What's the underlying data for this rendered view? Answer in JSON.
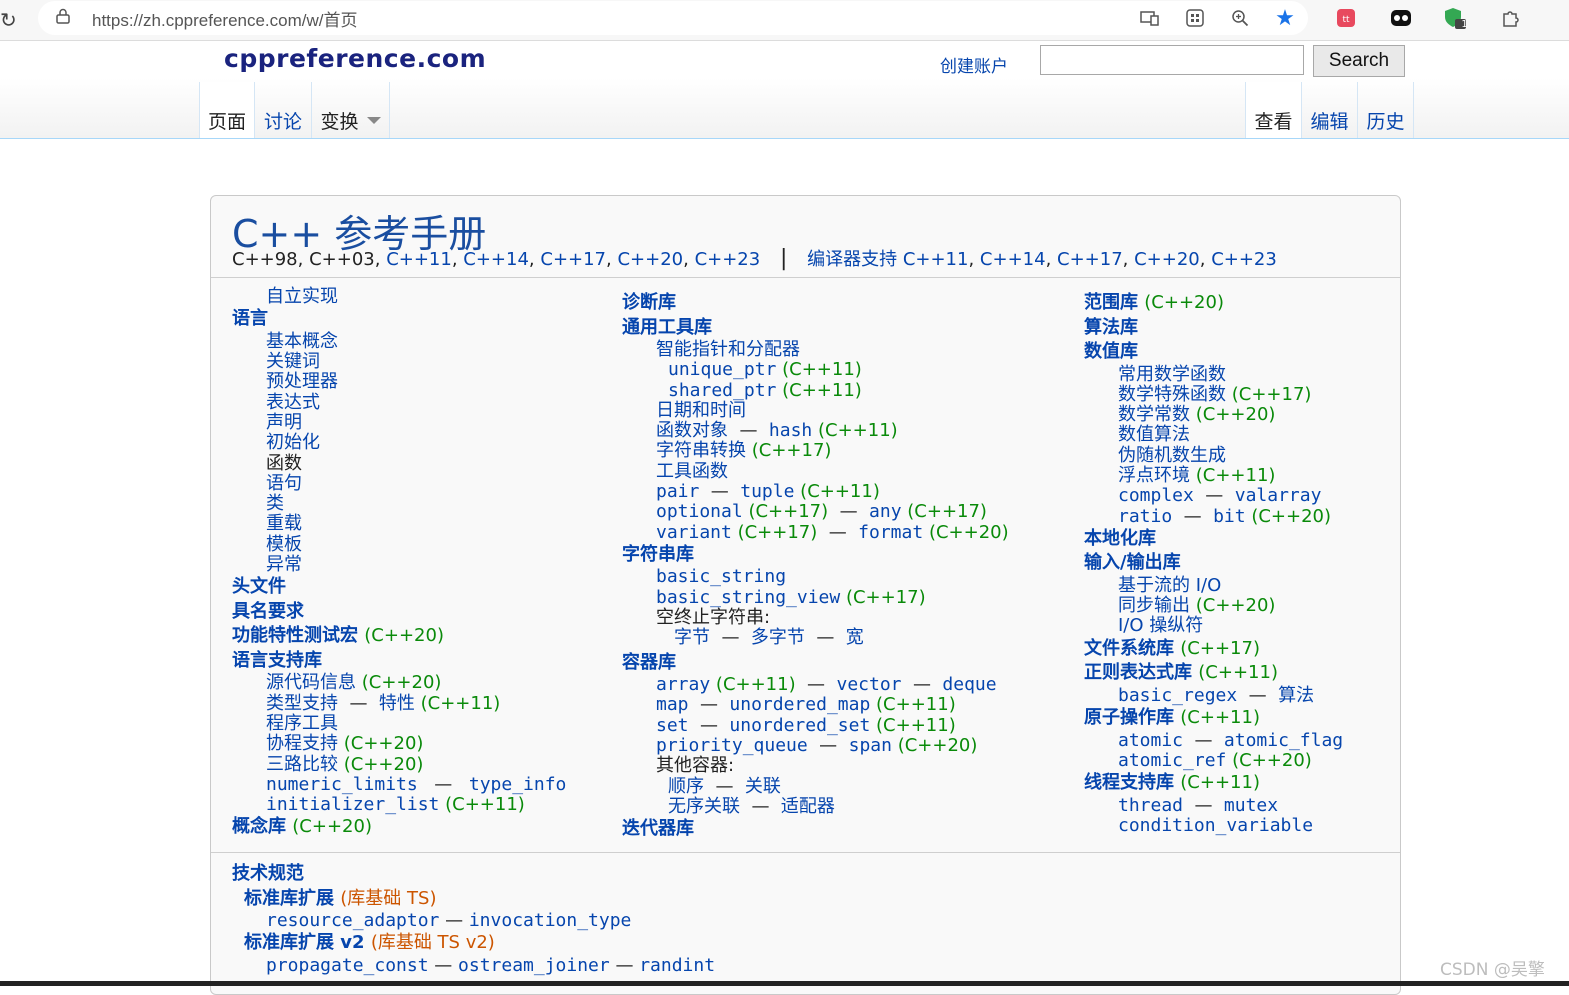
{
  "browser": {
    "url": "https://zh.cppreference.com/w/首页",
    "extension_badge": "1"
  },
  "site": {
    "logo": "cppreference.com",
    "create_account": "创建账户",
    "search_button": "Search",
    "search_placeholder": ""
  },
  "tabs_left": [
    "页面",
    "讨论",
    "变换"
  ],
  "tabs_right": [
    "查看",
    "编辑",
    "历史"
  ],
  "title": "C++ 参考手册",
  "std_versions_plain": "C++98, C++03,",
  "std_links": [
    "C++11",
    "C++14",
    "C++17",
    "C++20",
    "C++23"
  ],
  "compiler_support": "编译器支持",
  "compiler_links": [
    "C++11",
    "C++14",
    "C++17",
    "C++20",
    "C++23"
  ],
  "col1": {
    "freestanding": "自立实现",
    "language": "语言",
    "language_items": [
      "基本概念",
      "关键词",
      "预处理器",
      "表达式",
      "声明",
      "初始化",
      "函数",
      "语句",
      "类",
      "重载",
      "模板",
      "异常"
    ],
    "headers": "头文件",
    "named_req": "具名要求",
    "feature_test": "功能特性测试宏",
    "feature_test_ver": "(C++20)",
    "lang_support": "语言支持库",
    "source_location": "源代码信息",
    "source_location_ver": "(C++20)",
    "type_support": "类型支持",
    "traits": "特性",
    "traits_ver": "(C++11)",
    "program_utils": "程序工具",
    "coroutine": "协程支持",
    "coroutine_ver": "(C++20)",
    "three_way": "三路比较",
    "three_way_ver": "(C++20)",
    "numeric_limits": "numeric_limits",
    "type_info": "type_info",
    "initializer_list": "initializer_list",
    "initializer_list_ver": "(C++11)",
    "concepts": "概念库",
    "concepts_ver": "(C++20)"
  },
  "col2": {
    "diagnostics": "诊断库",
    "utilities": "通用工具库",
    "smart_ptr": "智能指针和分配器",
    "unique_ptr": "unique_ptr",
    "unique_ptr_ver": "(C++11)",
    "shared_ptr": "shared_ptr",
    "shared_ptr_ver": "(C++11)",
    "datetime": "日期和时间",
    "function_objects": "函数对象",
    "hash": "hash",
    "hash_ver": "(C++11)",
    "string_conv": "字符串转换",
    "string_conv_ver": "(C++17)",
    "utility_funcs": "工具函数",
    "pair": "pair",
    "tuple": "tuple",
    "tuple_ver": "(C++11)",
    "optional": "optional",
    "optional_ver": "(C++17)",
    "any": "any",
    "any_ver": "(C++17)",
    "variant": "variant",
    "variant_ver": "(C++17)",
    "format": "format",
    "format_ver": "(C++20)",
    "strings": "字符串库",
    "basic_string": "basic_string",
    "basic_string_view": "basic_string_view",
    "basic_string_view_ver": "(C++17)",
    "null_terminated": "空终止字符串:",
    "byte": "字节",
    "multibyte": "多字节",
    "wide": "宽",
    "containers": "容器库",
    "array": "array",
    "array_ver": "(C++11)",
    "vector": "vector",
    "deque": "deque",
    "map": "map",
    "unordered_map": "unordered_map",
    "unordered_map_ver": "(C++11)",
    "set": "set",
    "unordered_set": "unordered_set",
    "unordered_set_ver": "(C++11)",
    "priority_queue": "priority_queue",
    "span": "span",
    "span_ver": "(C++20)",
    "other_containers": "其他容器:",
    "sequence": "顺序",
    "associative": "关联",
    "unordered_assoc": "无序关联",
    "adaptors": "适配器",
    "iterators": "迭代器库"
  },
  "col3": {
    "ranges": "范围库",
    "ranges_ver": "(C++20)",
    "algorithms": "算法库",
    "numerics": "数值库",
    "common_math": "常用数学函数",
    "special_math": "数学特殊函数",
    "special_math_ver": "(C++17)",
    "math_constants": "数学常数",
    "math_constants_ver": "(C++20)",
    "numeric_algorithms": "数值算法",
    "prng": "伪随机数生成",
    "fenv": "浮点环境",
    "fenv_ver": "(C++11)",
    "complex": "complex",
    "valarray": "valarray",
    "ratio": "ratio",
    "bit": "bit",
    "bit_ver": "(C++20)",
    "localization": "本地化库",
    "io": "输入/输出库",
    "stream_io": "基于流的 I/O",
    "sync_output": "同步输出",
    "sync_output_ver": "(C++20)",
    "io_manip": "I/O 操纵符",
    "filesystem": "文件系统库",
    "filesystem_ver": "(C++17)",
    "regex": "正则表达式库",
    "regex_ver": "(C++11)",
    "basic_regex": "basic_regex",
    "regex_algorithms": "算法",
    "atomic_ops": "原子操作库",
    "atomic_ops_ver": "(C++11)",
    "atomic": "atomic",
    "atomic_flag": "atomic_flag",
    "atomic_ref": "atomic_ref",
    "atomic_ref_ver": "(C++20)",
    "thread": "线程支持库",
    "thread_ver": "(C++11)",
    "thread_class": "thread",
    "mutex": "mutex",
    "condition_variable": "condition_variable"
  },
  "techspecs": {
    "heading": "技术规范",
    "ext1": "标准库扩展",
    "ext1_note": "(库基础 TS)",
    "resource_adaptor": "resource_adaptor",
    "invocation_type": "invocation_type",
    "ext2": "标准库扩展 v2",
    "ext2_note": "(库基础 TS v2)",
    "propagate_const": "propagate_const",
    "ostream_joiner": "ostream_joiner",
    "randint": "randint"
  },
  "watermark": "CSDN @吴擎"
}
